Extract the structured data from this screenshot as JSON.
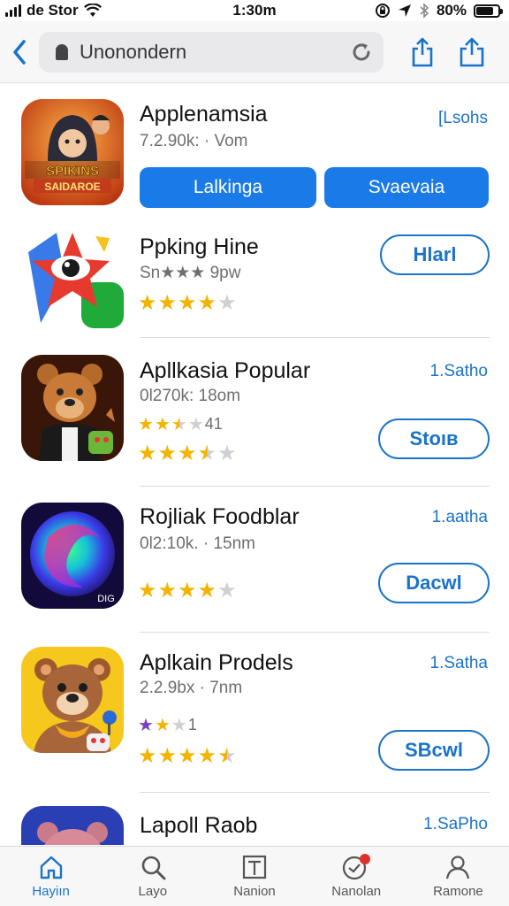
{
  "status_bar": {
    "carrier": "de Stor",
    "time": "1:30m",
    "battery": "80%",
    "battery_level": 0.8
  },
  "nav": {
    "search_value": "Unonondern"
  },
  "apps": [
    {
      "name": "Applenamsia",
      "meta": "7.2.90k: · Vom",
      "link": "[Lsohs",
      "button_left": "Lalkinga",
      "button_right": "Svaevaia",
      "icon": "game-hero-app-icon"
    },
    {
      "name": "Ppking Hine",
      "meta": "Sn★★★ 9pw",
      "stars": 4,
      "action": "Hlarl",
      "icon": "eye-star-app-icon"
    },
    {
      "name": "Apllkasia Popular",
      "meta": "0l270k: 18om",
      "sub_rating_text": "41",
      "stars": 3.5,
      "link": "1.Satho",
      "action": "Stoıв",
      "icon": "bear-mascot-app-icon"
    },
    {
      "name": "Rojliak Foodblar",
      "meta": "0l2:10k. · 15nm",
      "stars": 4,
      "link": "1.aatha",
      "action": "Dacwl",
      "icon": "gradient-swirl-app-icon",
      "icon_badge": "DIG"
    },
    {
      "name": "Aplkain Prodels",
      "meta": "2.2.9bx · 7nm",
      "sub_rating_text": "1",
      "stars": 4.5,
      "link": "1.Satha",
      "action": "SBcwl",
      "icon": "teddy-bear-app-icon"
    },
    {
      "name": "Lapoll Raob",
      "link": "1.SaPho",
      "icon": "pink-bear-app-icon"
    }
  ],
  "tabs": [
    {
      "label": "Hayiın",
      "icon": "home-icon",
      "active": true
    },
    {
      "label": "Layo",
      "icon": "search-icon"
    },
    {
      "label": "Nanion",
      "icon": "news-icon"
    },
    {
      "label": "Nanolan",
      "icon": "notification-icon"
    },
    {
      "label": "Ramone",
      "icon": "profile-icon"
    }
  ],
  "colors": {
    "accent": "#1a73c9",
    "button_blue": "#1a7be8",
    "star": "#f5b301"
  }
}
